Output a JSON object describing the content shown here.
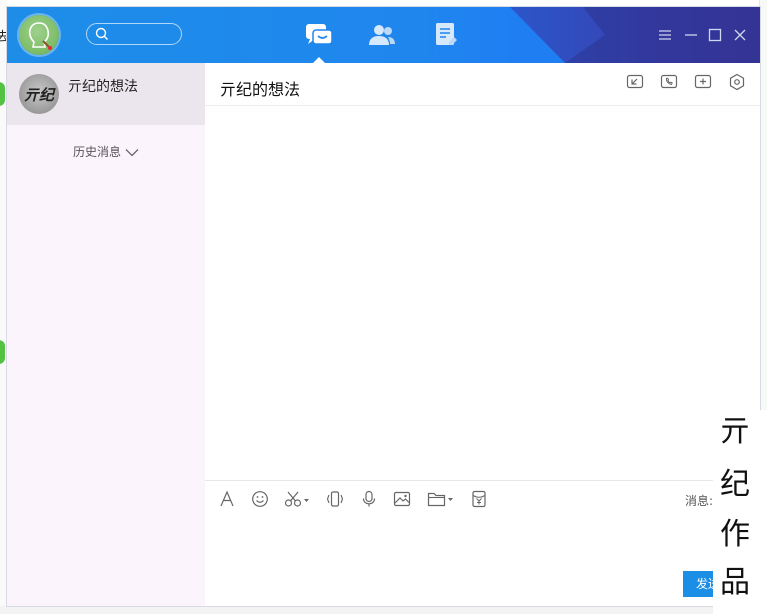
{
  "user": {
    "avatar_icon": "user-avatar"
  },
  "search": {
    "icon": "search-icon"
  },
  "nav": {
    "tabs": [
      {
        "name": "messages",
        "icon": "chat-bubbles-icon",
        "active": true
      },
      {
        "name": "contacts",
        "icon": "contacts-icon",
        "active": false
      },
      {
        "name": "files",
        "icon": "document-icon",
        "active": false
      }
    ]
  },
  "window_controls": [
    "menu-icon",
    "minimize-icon",
    "maximize-icon",
    "close-icon"
  ],
  "sidebar": {
    "items": [
      {
        "name": "亓纪的想法",
        "avatar_text": "亓纪",
        "selected": true
      }
    ],
    "history_label": "历史消息"
  },
  "chat": {
    "title": "亓纪的想法",
    "header_actions": [
      "share-screen-icon",
      "voice-call-icon",
      "add-member-icon",
      "settings-icon"
    ],
    "toolbar": [
      "font-icon",
      "emoji-icon",
      "screenshot-icon",
      "shake-icon",
      "voice-message-icon",
      "image-icon",
      "folder-icon",
      "red-packet-icon"
    ],
    "message_record_label": "消息:",
    "send_label": "发送"
  },
  "watermark": {
    "chars": [
      "亓",
      "纪",
      "作",
      "品"
    ]
  },
  "colors": {
    "titlebar": "#1f86ee",
    "titlebar_dark": "#3a3fae",
    "sidebar": "#fbf4fc",
    "selected": "#ebe6ed",
    "send": "#1c8ee6"
  }
}
